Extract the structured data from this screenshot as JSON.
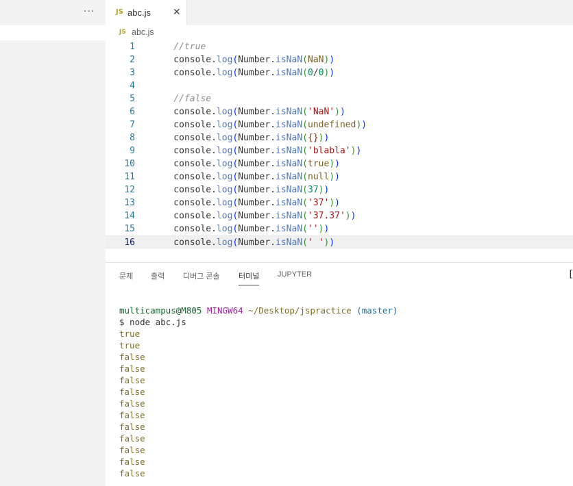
{
  "sidebar": {
    "more_actions": "···"
  },
  "tab": {
    "badge": "JS",
    "label": "abc.js",
    "close": "✕"
  },
  "breadcrumb": {
    "badge": "JS",
    "label": "abc.js"
  },
  "editor": {
    "current_line": 16,
    "lines": [
      {
        "n": "1",
        "tokens": [
          [
            "    ",
            "plain"
          ],
          [
            "//true",
            "comment"
          ]
        ]
      },
      {
        "n": "2",
        "tokens": [
          [
            "    console.",
            "plain"
          ],
          [
            "log",
            "fn"
          ],
          [
            "(",
            "paren1"
          ],
          [
            "Number.",
            "plain"
          ],
          [
            "isNaN",
            "fn"
          ],
          [
            "(",
            "paren2"
          ],
          [
            "NaN",
            "kw"
          ],
          [
            ")",
            "paren2"
          ],
          [
            ")",
            "paren1"
          ]
        ]
      },
      {
        "n": "3",
        "tokens": [
          [
            "    console.",
            "plain"
          ],
          [
            "log",
            "fn"
          ],
          [
            "(",
            "paren1"
          ],
          [
            "Number.",
            "plain"
          ],
          [
            "isNaN",
            "fn"
          ],
          [
            "(",
            "paren2"
          ],
          [
            "0",
            "num"
          ],
          [
            "/",
            "plain"
          ],
          [
            "0",
            "num"
          ],
          [
            ")",
            "paren2"
          ],
          [
            ")",
            "paren1"
          ]
        ]
      },
      {
        "n": "4",
        "tokens": []
      },
      {
        "n": "5",
        "tokens": [
          [
            "    ",
            "plain"
          ],
          [
            "//false",
            "comment"
          ]
        ]
      },
      {
        "n": "6",
        "tokens": [
          [
            "    console.",
            "plain"
          ],
          [
            "log",
            "fn"
          ],
          [
            "(",
            "paren1"
          ],
          [
            "Number.",
            "plain"
          ],
          [
            "isNaN",
            "fn"
          ],
          [
            "(",
            "paren2"
          ],
          [
            "'NaN'",
            "str"
          ],
          [
            ")",
            "paren2"
          ],
          [
            ")",
            "paren1"
          ]
        ]
      },
      {
        "n": "7",
        "tokens": [
          [
            "    console.",
            "plain"
          ],
          [
            "log",
            "fn"
          ],
          [
            "(",
            "paren1"
          ],
          [
            "Number.",
            "plain"
          ],
          [
            "isNaN",
            "fn"
          ],
          [
            "(",
            "paren2"
          ],
          [
            "undefined",
            "kw"
          ],
          [
            ")",
            "paren2"
          ],
          [
            ")",
            "paren1"
          ]
        ]
      },
      {
        "n": "8",
        "tokens": [
          [
            "    console.",
            "plain"
          ],
          [
            "log",
            "fn"
          ],
          [
            "(",
            "paren1"
          ],
          [
            "Number.",
            "plain"
          ],
          [
            "isNaN",
            "fn"
          ],
          [
            "(",
            "paren2"
          ],
          [
            "{",
            "paren3"
          ],
          [
            "}",
            "paren3"
          ],
          [
            ")",
            "paren2"
          ],
          [
            ")",
            "paren1"
          ]
        ]
      },
      {
        "n": "9",
        "tokens": [
          [
            "    console.",
            "plain"
          ],
          [
            "log",
            "fn"
          ],
          [
            "(",
            "paren1"
          ],
          [
            "Number.",
            "plain"
          ],
          [
            "isNaN",
            "fn"
          ],
          [
            "(",
            "paren2"
          ],
          [
            "'blabla'",
            "str"
          ],
          [
            ")",
            "paren2"
          ],
          [
            ")",
            "paren1"
          ]
        ]
      },
      {
        "n": "10",
        "tokens": [
          [
            "    console.",
            "plain"
          ],
          [
            "log",
            "fn"
          ],
          [
            "(",
            "paren1"
          ],
          [
            "Number.",
            "plain"
          ],
          [
            "isNaN",
            "fn"
          ],
          [
            "(",
            "paren2"
          ],
          [
            "true",
            "kw"
          ],
          [
            ")",
            "paren2"
          ],
          [
            ")",
            "paren1"
          ]
        ]
      },
      {
        "n": "11",
        "tokens": [
          [
            "    console.",
            "plain"
          ],
          [
            "log",
            "fn"
          ],
          [
            "(",
            "paren1"
          ],
          [
            "Number.",
            "plain"
          ],
          [
            "isNaN",
            "fn"
          ],
          [
            "(",
            "paren2"
          ],
          [
            "null",
            "kw"
          ],
          [
            ")",
            "paren2"
          ],
          [
            ")",
            "paren1"
          ]
        ]
      },
      {
        "n": "12",
        "tokens": [
          [
            "    console.",
            "plain"
          ],
          [
            "log",
            "fn"
          ],
          [
            "(",
            "paren1"
          ],
          [
            "Number.",
            "plain"
          ],
          [
            "isNaN",
            "fn"
          ],
          [
            "(",
            "paren2"
          ],
          [
            "37",
            "num"
          ],
          [
            ")",
            "paren2"
          ],
          [
            ")",
            "paren1"
          ]
        ]
      },
      {
        "n": "13",
        "tokens": [
          [
            "    console.",
            "plain"
          ],
          [
            "log",
            "fn"
          ],
          [
            "(",
            "paren1"
          ],
          [
            "Number.",
            "plain"
          ],
          [
            "isNaN",
            "fn"
          ],
          [
            "(",
            "paren2"
          ],
          [
            "'37'",
            "str"
          ],
          [
            ")",
            "paren2"
          ],
          [
            ")",
            "paren1"
          ]
        ]
      },
      {
        "n": "14",
        "tokens": [
          [
            "    console.",
            "plain"
          ],
          [
            "log",
            "fn"
          ],
          [
            "(",
            "paren1"
          ],
          [
            "Number.",
            "plain"
          ],
          [
            "isNaN",
            "fn"
          ],
          [
            "(",
            "paren2"
          ],
          [
            "'37.37'",
            "str"
          ],
          [
            ")",
            "paren2"
          ],
          [
            ")",
            "paren1"
          ]
        ]
      },
      {
        "n": "15",
        "tokens": [
          [
            "    console.",
            "plain"
          ],
          [
            "log",
            "fn"
          ],
          [
            "(",
            "paren1"
          ],
          [
            "Number.",
            "plain"
          ],
          [
            "isNaN",
            "fn"
          ],
          [
            "(",
            "paren2"
          ],
          [
            "''",
            "str"
          ],
          [
            ")",
            "paren2"
          ],
          [
            ")",
            "paren1"
          ]
        ]
      },
      {
        "n": "16",
        "tokens": [
          [
            "    console.",
            "plain"
          ],
          [
            "log",
            "fn"
          ],
          [
            "(",
            "paren1"
          ],
          [
            "Number.",
            "plain"
          ],
          [
            "isNaN",
            "fn"
          ],
          [
            "(",
            "paren2"
          ],
          [
            "' '",
            "str"
          ],
          [
            ")",
            "paren2"
          ],
          [
            ")",
            "paren1"
          ]
        ]
      }
    ]
  },
  "panel": {
    "tabs": [
      {
        "id": "problems",
        "label": "문제",
        "active": false
      },
      {
        "id": "output",
        "label": "출력",
        "active": false
      },
      {
        "id": "debug-console",
        "label": "디버그 콘솔",
        "active": false
      },
      {
        "id": "terminal",
        "label": "터미널",
        "active": true
      },
      {
        "id": "jupyter",
        "label": "JUPYTER",
        "active": false
      }
    ],
    "edge_glyph": "["
  },
  "terminal": {
    "prompt": {
      "user": "multicampus@M805",
      "host": "MINGW64",
      "path": "~/Desktop/jspractice",
      "branch": "(master)"
    },
    "command": "$ node abc.js",
    "output": [
      "true",
      "true",
      "false",
      "false",
      "false",
      "false",
      "false",
      "false",
      "false",
      "false",
      "false",
      "false",
      "false"
    ]
  },
  "colors": {
    "sidebar_bg": "#f3f3f3",
    "current_line_bg": "#f0f0f0",
    "line_number": "#237893",
    "js_badge": "#b3a12c"
  }
}
